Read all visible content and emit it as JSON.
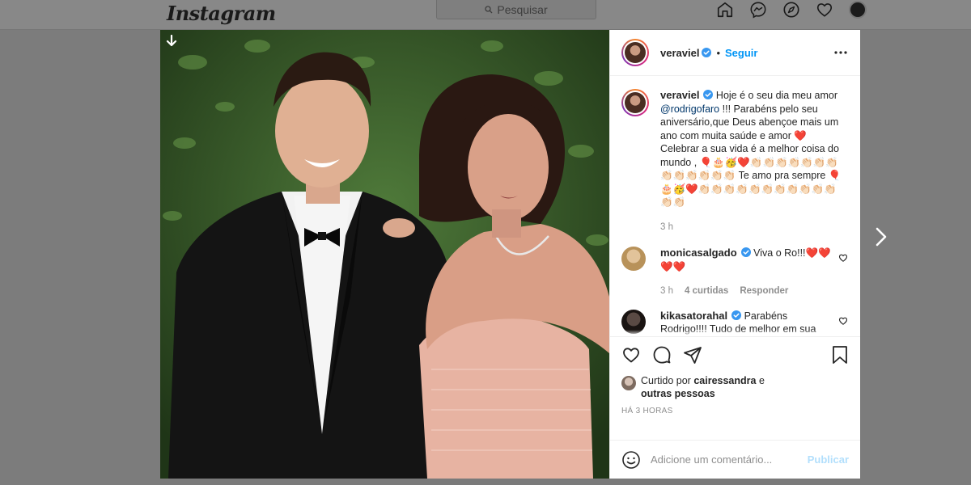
{
  "app": {
    "logo_text": "Instagram"
  },
  "topbar": {
    "search_placeholder": "Pesquisar",
    "icons": [
      "home-icon",
      "messenger-icon",
      "explore-icon",
      "activity-heart-icon",
      "profile-avatar"
    ]
  },
  "post": {
    "author": "veraviel",
    "separator": "•",
    "follow_label": "Seguir",
    "caption": {
      "username": "veraviel",
      "text_1": "Hoje é o seu dia meu amor",
      "mention": "@rodrigofaro",
      "text_2": "!!! Parabéns pelo seu aniversário,que Deus abençoe mais um ano com muita saúde e amor ❤️ Celebrar a sua vida é a melhor coisa do mundo , 🎈🎂🥳❤️👏🏻👏🏻👏🏻👏🏻👏🏻👏🏻👏🏻👏🏻👏🏻👏🏻👏🏻👏🏻👏🏻 Te amo pra sempre 🎈🎂🥳❤️👏🏻👏🏻👏🏻👏🏻👏🏻👏🏻👏🏻👏🏻👏🏻👏🏻👏🏻👏🏻👏🏻",
      "time": "3 h"
    },
    "comments": [
      {
        "username": "monicasalgado",
        "text": "Viva o Ro!!!❤️❤️❤️❤️",
        "time": "3 h",
        "likes": "4 curtidas",
        "reply": "Responder"
      },
      {
        "username": "kikasatorahal",
        "text": "Parabéns Rodrigo!!!! Tudo de melhor em sua vida nesse novo ano 👏🏻❤️❤️❤️"
      }
    ],
    "liked_by_prefix": "Curtido por",
    "liked_by_user": "cairessandra",
    "liked_by_conj": "e",
    "liked_by_others": "outras pessoas",
    "timestamp": "HÁ 3 HORAS",
    "add_comment_placeholder": "Adicione um comentário...",
    "publish_label": "Publicar"
  },
  "colors": {
    "accent": "#0095f6",
    "mention": "#00376b",
    "muted": "#8e8e8e",
    "publish_disabled": "#b2dffc",
    "heart": "#ed4956"
  }
}
